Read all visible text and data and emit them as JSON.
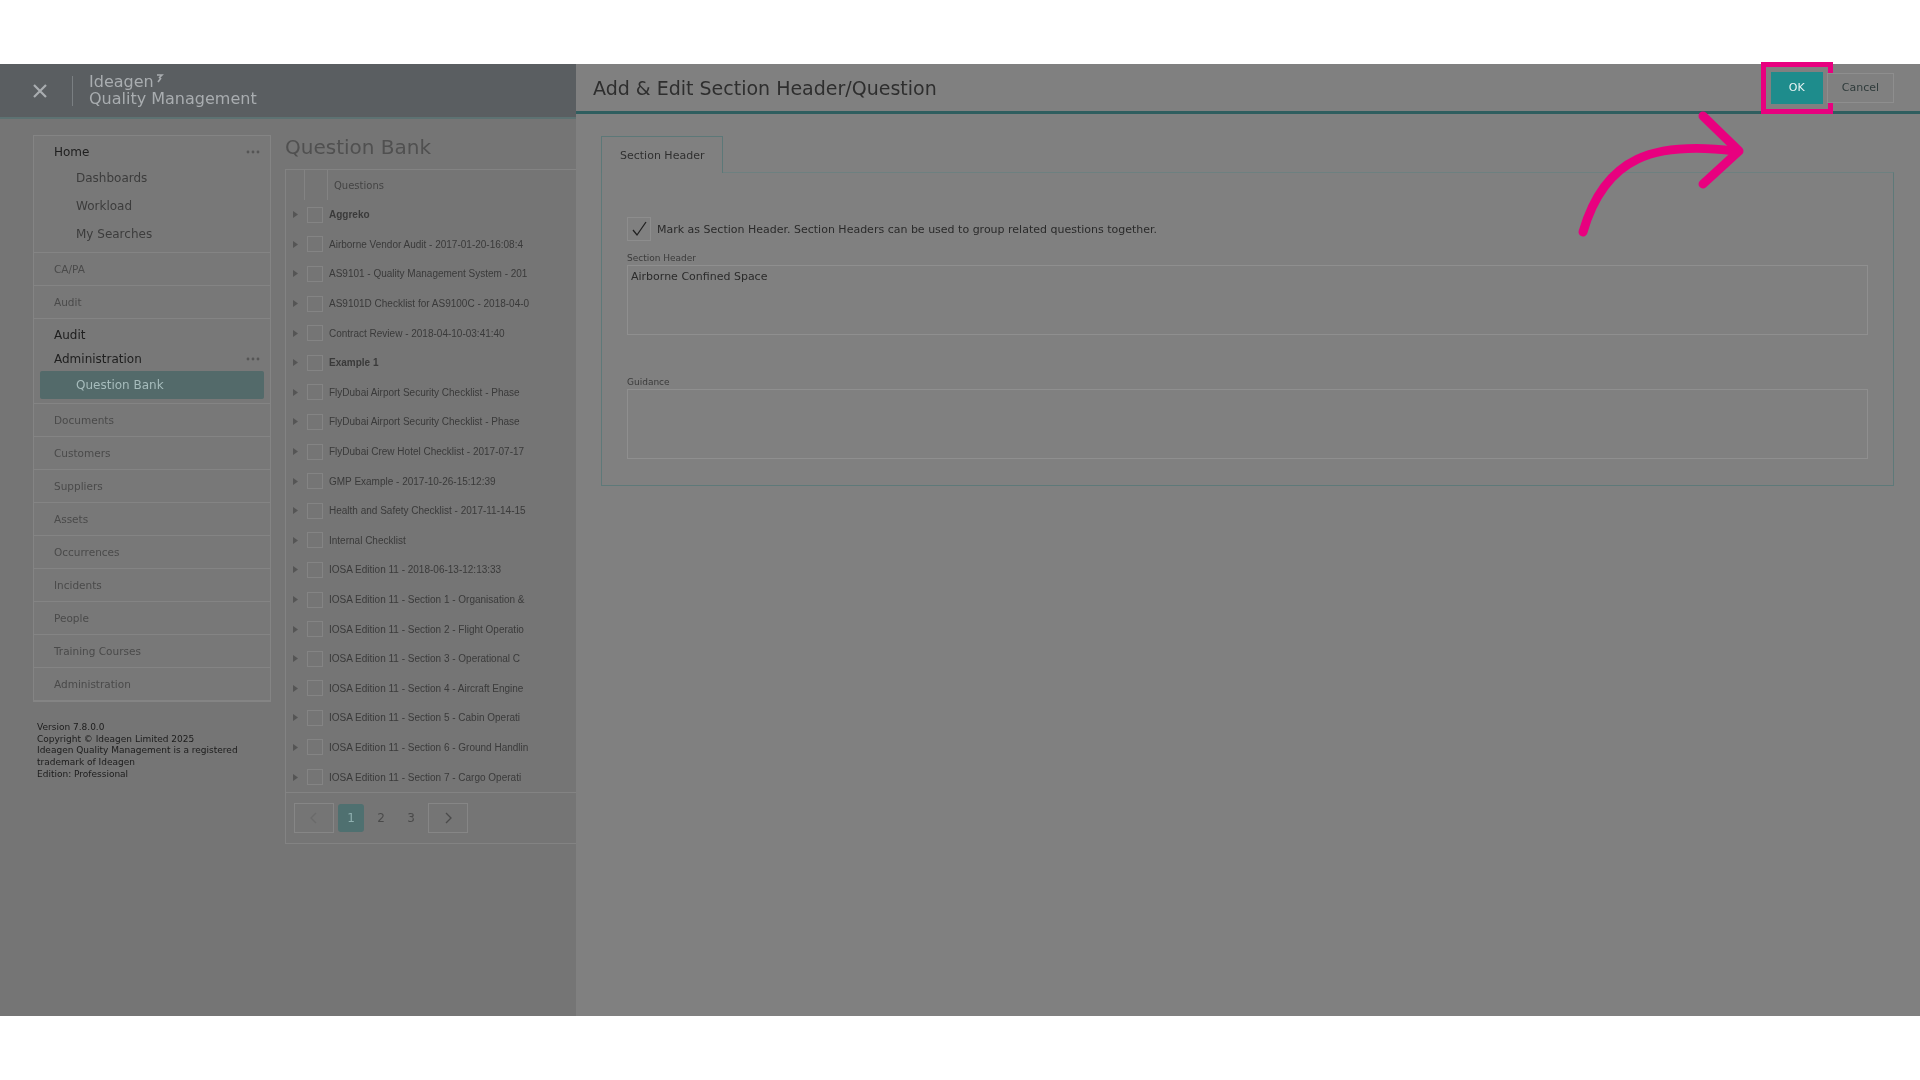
{
  "app": {
    "brand": "Ideagen",
    "product": "Quality Management"
  },
  "sidebar": {
    "groups": [
      {
        "items": [
          {
            "label": "Home",
            "muted": false,
            "menu": true,
            "children": [
              {
                "label": "Dashboards",
                "selected": false
              },
              {
                "label": "Workload",
                "selected": false
              },
              {
                "label": "My Searches",
                "selected": false
              }
            ]
          }
        ]
      },
      {
        "items": [
          {
            "label": "CA/PA",
            "muted": true,
            "menu": false
          }
        ]
      },
      {
        "items": [
          {
            "label": "Audit",
            "muted": true,
            "menu": false
          }
        ]
      },
      {
        "items": [
          {
            "label": "Audit",
            "muted": false,
            "menu": false
          },
          {
            "label": "Administration",
            "muted": false,
            "menu": true,
            "children": [
              {
                "label": "Question Bank",
                "selected": true
              }
            ]
          }
        ]
      },
      {
        "items": [
          {
            "label": "Documents",
            "muted": true,
            "menu": false
          }
        ]
      },
      {
        "items": [
          {
            "label": "Customers",
            "muted": true,
            "menu": false
          }
        ]
      },
      {
        "items": [
          {
            "label": "Suppliers",
            "muted": true,
            "menu": false
          }
        ]
      },
      {
        "items": [
          {
            "label": "Assets",
            "muted": true,
            "menu": false
          }
        ]
      },
      {
        "items": [
          {
            "label": "Occurrences",
            "muted": true,
            "menu": false
          }
        ]
      },
      {
        "items": [
          {
            "label": "Incidents",
            "muted": true,
            "menu": false
          }
        ]
      },
      {
        "items": [
          {
            "label": "People",
            "muted": true,
            "menu": false
          }
        ]
      },
      {
        "items": [
          {
            "label": "Training Courses",
            "muted": true,
            "menu": false
          }
        ]
      },
      {
        "items": [
          {
            "label": "Administration",
            "muted": true,
            "menu": false
          }
        ]
      }
    ],
    "footer": [
      "Version 7.8.0.0",
      "Copyright © Ideagen Limited 2025",
      "Ideagen Quality Management is a registered trademark of Ideagen",
      "Edition: Professional"
    ]
  },
  "question_bank": {
    "title": "Question Bank",
    "column": "Questions",
    "rows": [
      {
        "text": "Aggreko",
        "bold": true,
        "checked": false
      },
      {
        "text": "Airborne Vendor Audit - 2017-01-20-16:08:4",
        "bold": false,
        "checked": false
      },
      {
        "text": "AS9101 - Quality Management System - 201",
        "bold": false,
        "checked": false
      },
      {
        "text": "AS9101D Checklist for AS9100C - 2018-04-0",
        "bold": false,
        "checked": false
      },
      {
        "text": "Contract Review - 2018-04-10-03:41:40",
        "bold": false,
        "checked": false
      },
      {
        "text": "Example 1",
        "bold": true,
        "checked": false
      },
      {
        "text": "FlyDubai Airport Security Checklist - Phase",
        "bold": false,
        "checked": false
      },
      {
        "text": "FlyDubai Airport Security Checklist - Phase",
        "bold": false,
        "checked": false
      },
      {
        "text": "FlyDubai Crew Hotel Checklist - 2017-07-17",
        "bold": false,
        "checked": false
      },
      {
        "text": "GMP Example - 2017-10-26-15:12:39",
        "bold": false,
        "checked": false
      },
      {
        "text": "Health and Safety Checklist - 2017-11-14-15",
        "bold": false,
        "checked": false
      },
      {
        "text": "Internal Checklist",
        "bold": false,
        "checked": false
      },
      {
        "text": "IOSA Edition 11 - 2018-06-13-12:13:33",
        "bold": false,
        "checked": false
      },
      {
        "text": "IOSA Edition 11 - Section 1 - Organisation &",
        "bold": false,
        "checked": false
      },
      {
        "text": "IOSA Edition 11 - Section 2 - Flight Operatio",
        "bold": false,
        "checked": false
      },
      {
        "text": "IOSA Edition 11 - Section 3 - Operational C",
        "bold": false,
        "checked": false
      },
      {
        "text": "IOSA Edition 11 - Section 4 - Aircraft Engine",
        "bold": false,
        "checked": false
      },
      {
        "text": "IOSA Edition 11 - Section 5 - Cabin Operati",
        "bold": false,
        "checked": false
      },
      {
        "text": "IOSA Edition 11 - Section 6 - Ground Handlin",
        "bold": false,
        "checked": false
      },
      {
        "text": "IOSA Edition 11 - Section 7 - Cargo Operati",
        "bold": false,
        "checked": false
      }
    ],
    "pages": [
      {
        "label": "1",
        "selected": true
      },
      {
        "label": "2",
        "selected": false
      },
      {
        "label": "3",
        "selected": false
      }
    ]
  },
  "dialog": {
    "title": "Add & Edit Section Header/Question",
    "buttons": [
      {
        "label": "OK",
        "kind": "primary",
        "highlighted": true
      },
      {
        "label": "Cancel",
        "kind": "secondary",
        "highlighted": false
      }
    ],
    "tabs": [
      {
        "label": "Section Header",
        "selected": true
      }
    ],
    "checkbox": {
      "label": "Mark as Section Header. Section Headers can be used to group related questions together.",
      "checked": true
    },
    "fields": [
      {
        "label": "Section Header",
        "value": "Airborne Confined Space"
      },
      {
        "label": "Guidance"
      }
    ]
  }
}
